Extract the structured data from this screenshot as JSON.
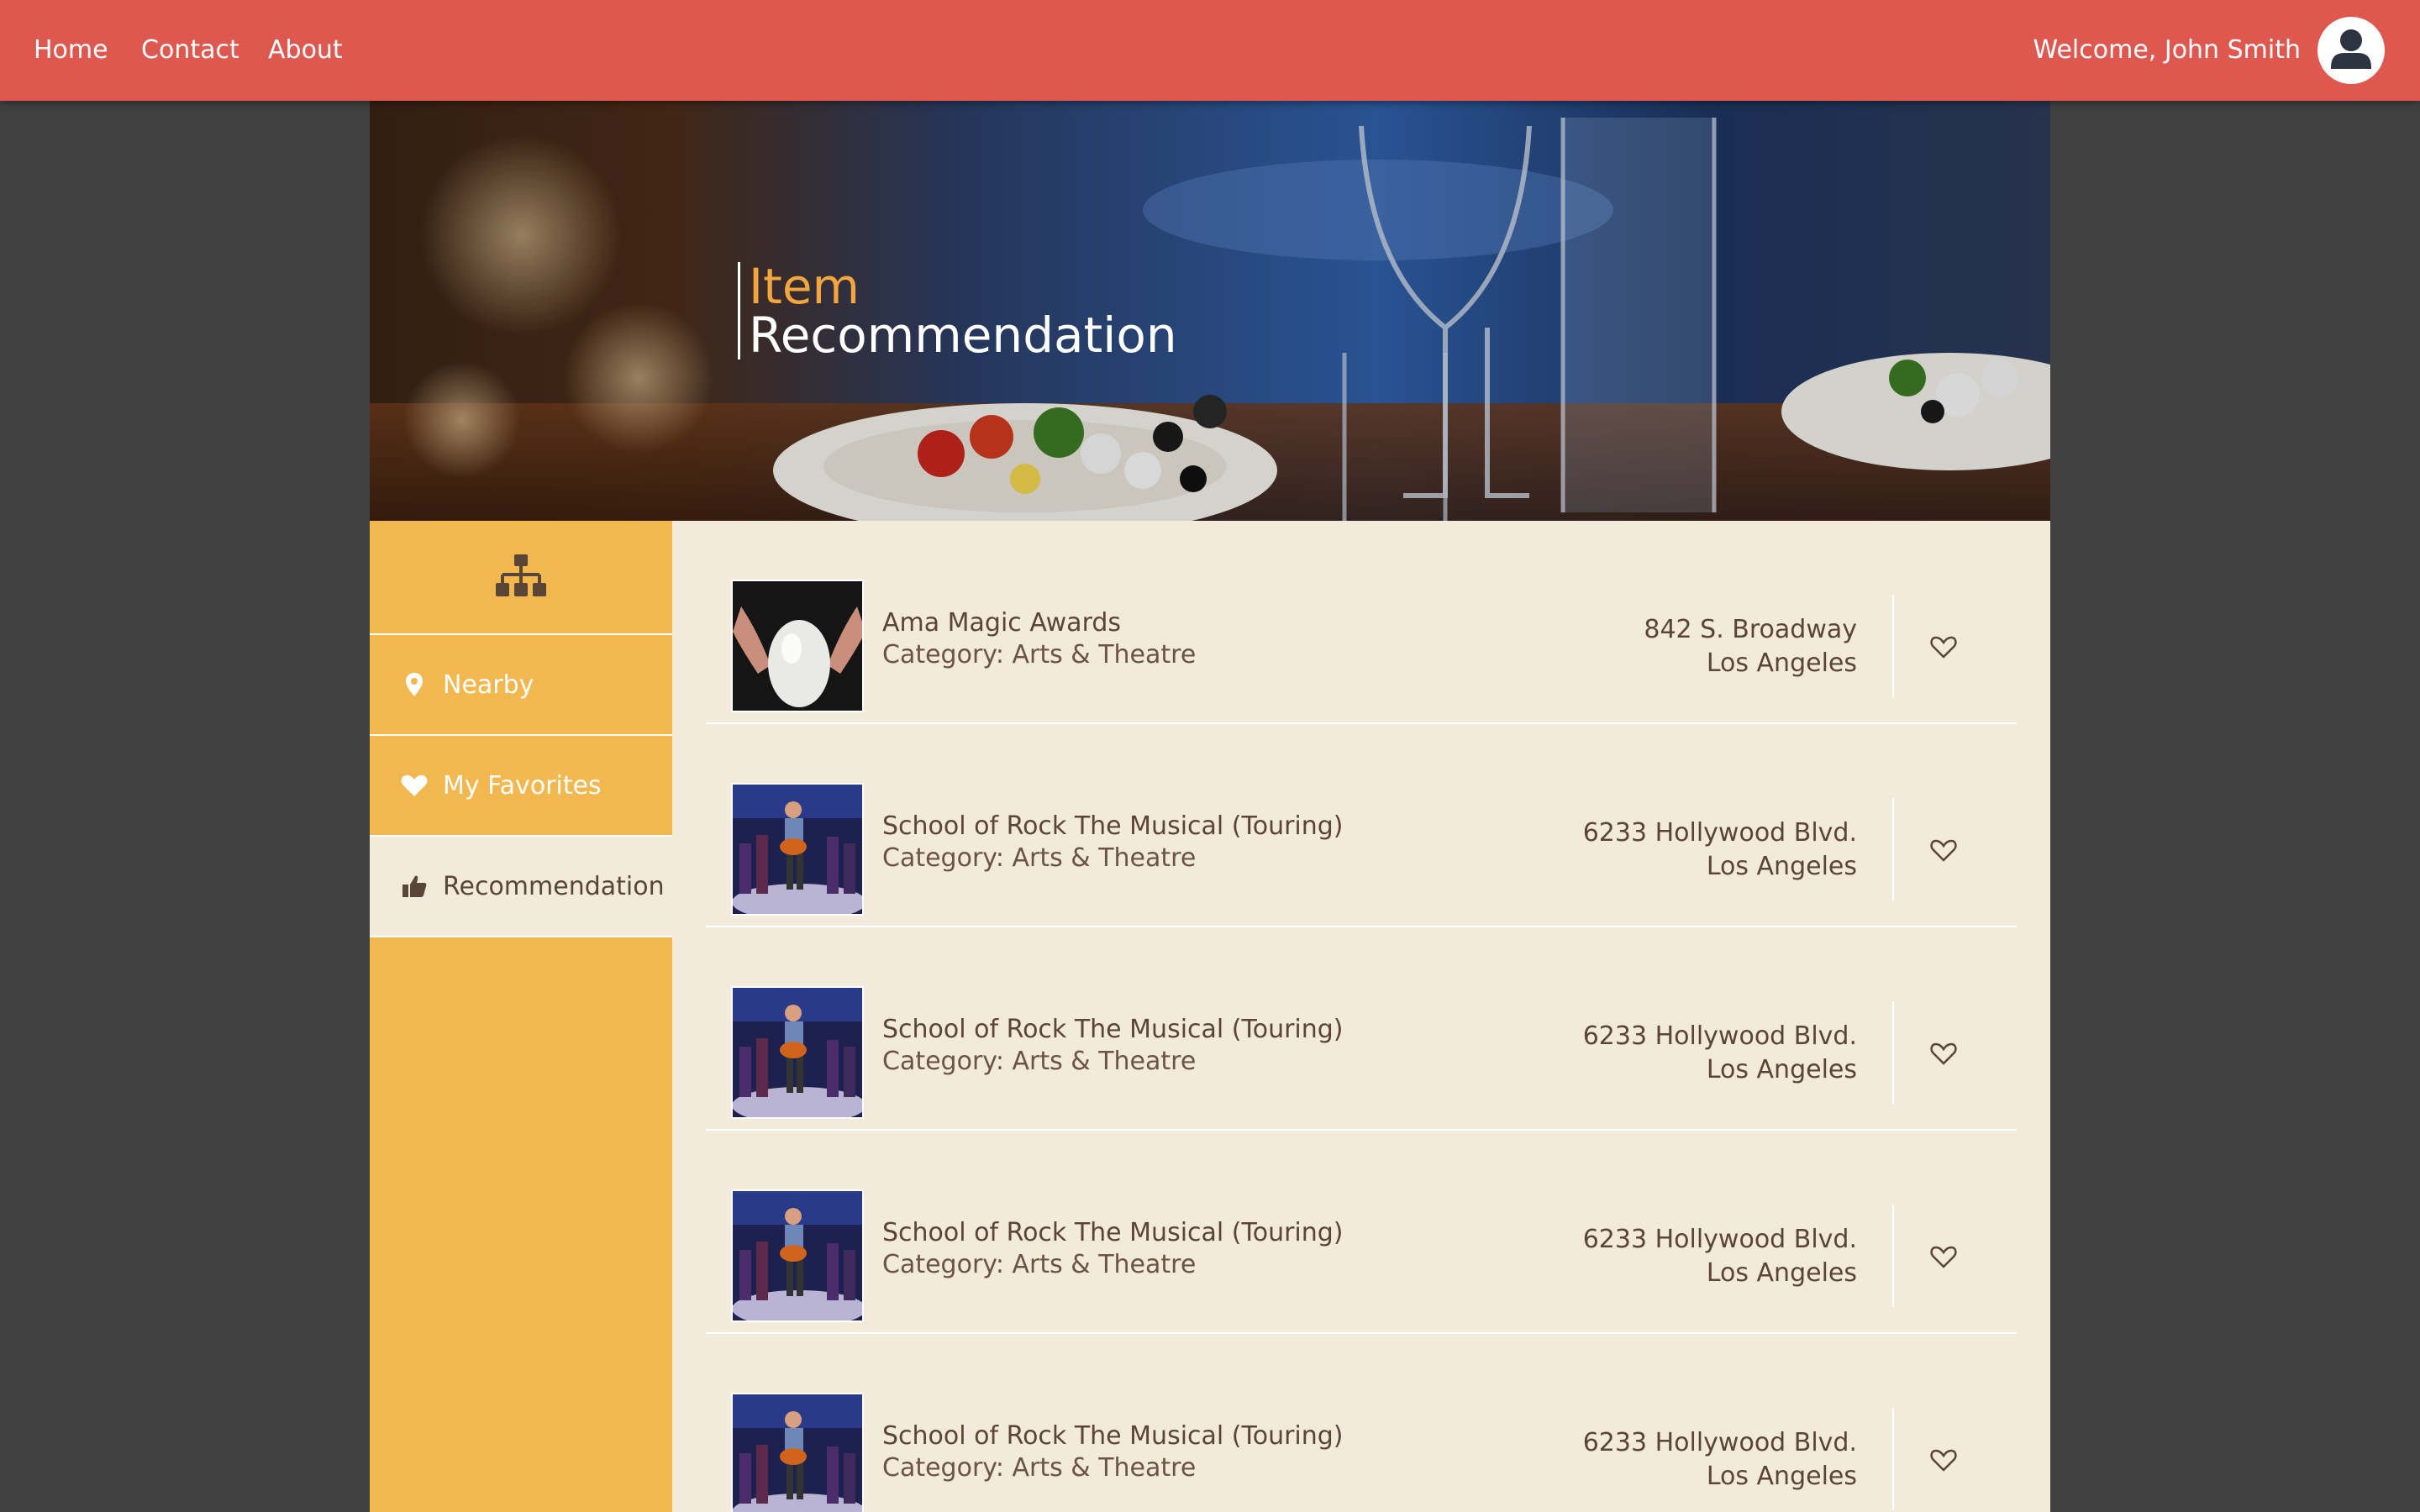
{
  "nav": {
    "links": [
      "Home",
      "Contact",
      "About"
    ],
    "welcome": "Welcome, John Smith",
    "avatar_icon": "user-icon"
  },
  "hero": {
    "line1": "Item",
    "line2": "Recommendation"
  },
  "sidebar": {
    "top_icon": "sitemap-icon",
    "items": [
      {
        "label": "Nearby",
        "icon": "map-marker-icon",
        "active": false
      },
      {
        "label": "My Favorites",
        "icon": "heart-icon",
        "active": false
      },
      {
        "label": "Recommendation",
        "icon": "thumbs-up-icon",
        "active": true
      }
    ]
  },
  "items": [
    {
      "name": "Ama Magic Awards",
      "category": "Category: Arts & Theatre",
      "address_line1": "842 S. Broadway",
      "address_line2": "Los Angeles",
      "image": "magic-egg",
      "favorite_icon": "heart-outline-icon"
    },
    {
      "name": "School of Rock The Musical (Touring)",
      "category": "Category: Arts & Theatre",
      "address_line1": "6233 Hollywood Blvd.",
      "address_line2": "Los Angeles",
      "image": "musical-stage",
      "favorite_icon": "heart-outline-icon"
    },
    {
      "name": "School of Rock The Musical (Touring)",
      "category": "Category: Arts & Theatre",
      "address_line1": "6233 Hollywood Blvd.",
      "address_line2": "Los Angeles",
      "image": "musical-stage",
      "favorite_icon": "heart-outline-icon"
    },
    {
      "name": "School of Rock The Musical (Touring)",
      "category": "Category: Arts & Theatre",
      "address_line1": "6233 Hollywood Blvd.",
      "address_line2": "Los Angeles",
      "image": "musical-stage",
      "favorite_icon": "heart-outline-icon"
    },
    {
      "name": "School of Rock The Musical (Touring)",
      "category": "Category: Arts & Theatre",
      "address_line1": "6233 Hollywood Blvd.",
      "address_line2": "Los Angeles",
      "image": "musical-stage",
      "favorite_icon": "heart-outline-icon"
    }
  ],
  "colors": {
    "topbar": "#df5850",
    "sidebar": "#f2b84f",
    "content_bg": "#f2eadb",
    "page_bg": "#414141",
    "hero_accent": "#f3a53e",
    "text_brown": "#5b4535"
  }
}
